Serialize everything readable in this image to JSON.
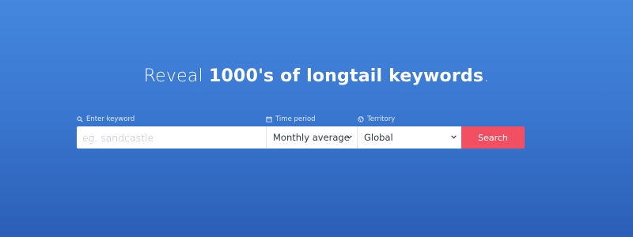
{
  "hero": {
    "headline_prefix": "Reveal ",
    "headline_bold": "1000's of longtail keywords",
    "headline_suffix": "."
  },
  "form": {
    "keyword": {
      "label": "Enter keyword",
      "icon": "search-icon",
      "placeholder": "eg, sandcastle",
      "value": ""
    },
    "time_period": {
      "label": "Time period",
      "icon": "calendar-icon",
      "selected": "Monthly average"
    },
    "territory": {
      "label": "Territory",
      "icon": "globe-icon",
      "selected": "Global"
    },
    "search_button": "Search"
  },
  "colors": {
    "background_top": "#4487de",
    "background_bottom": "#2c5fb7",
    "search_button": "#f24f62"
  }
}
